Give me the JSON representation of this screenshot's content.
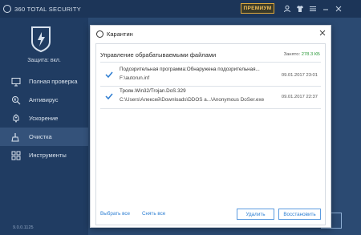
{
  "app": {
    "title": "360 TOTAL SECURITY",
    "premium_label": "ПРЕМИУМ",
    "protection_status": "Защита: вкл.",
    "version": "9.0.0.1125"
  },
  "sidebar": {
    "items": [
      {
        "label": "Полная проверка",
        "icon": "computer-scan-icon",
        "active": false
      },
      {
        "label": "Антивирус",
        "icon": "antivirus-icon",
        "active": false
      },
      {
        "label": "Ускорение",
        "icon": "speedup-icon",
        "active": false
      },
      {
        "label": "Очистка",
        "icon": "broom-icon",
        "active": true
      },
      {
        "label": "Инструменты",
        "icon": "tools-icon",
        "active": false
      }
    ]
  },
  "dialog": {
    "title": "Карантин",
    "section_title": "Управление обрабатываемыми файлами",
    "occupied_label": "Занято:",
    "occupied_value": "278.3 КБ",
    "items": [
      {
        "name": "Подозрительная программа:Обнаружена подозрительная...",
        "path": "F:\\autorun.inf",
        "date": "09.01.2017 23:01"
      },
      {
        "name": "Троян.Win32/Trojan.DoS.329",
        "path": "C:\\Users\\Алексей\\Downloads\\DDOS а...\\Anonymous DoSer.exe",
        "date": "09.01.2017 22:37"
      }
    ],
    "select_all": "Выбрать все",
    "deselect_all": "Снять все",
    "delete_label": "Удалить",
    "restore_label": "Восстановить"
  },
  "colors": {
    "accent": "#2d7fd3",
    "sidebar": "#203c62",
    "premium": "#f3c15a",
    "size_green": "#2c9a3a"
  }
}
